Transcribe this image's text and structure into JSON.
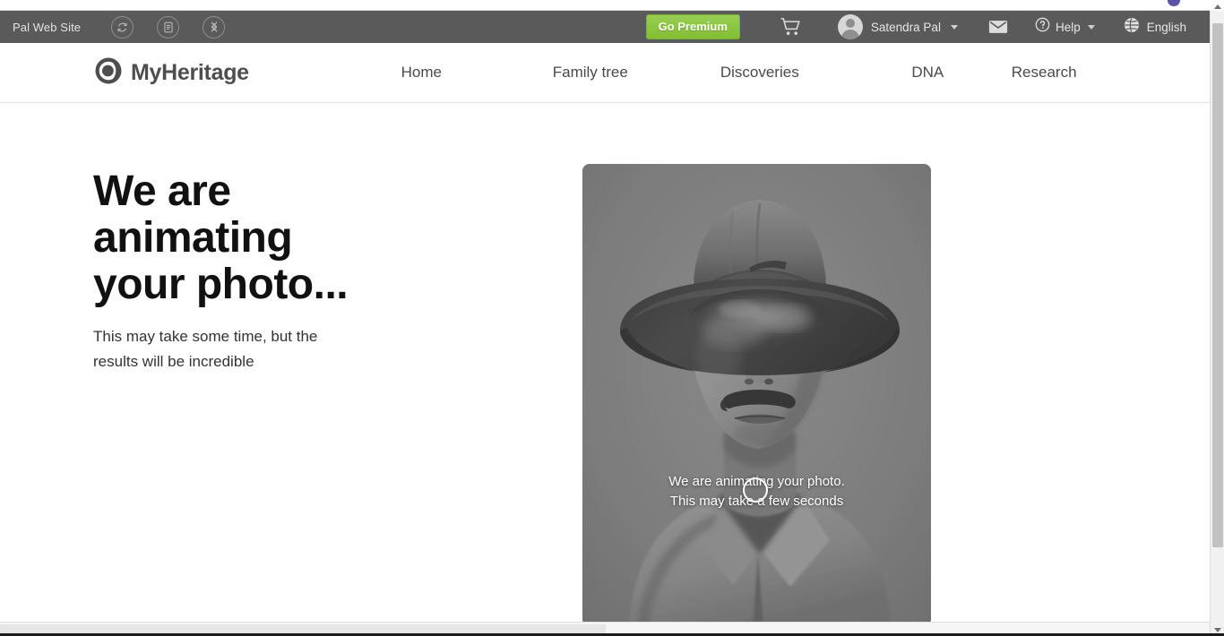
{
  "browser": {
    "tab_favicon_icon": "purple-circle-favicon"
  },
  "utility_bar": {
    "site_name": "Pal Web Site",
    "quick_icons": [
      {
        "name": "sync-icon",
        "label": "Sync"
      },
      {
        "name": "records-icon",
        "label": "Records"
      },
      {
        "name": "dna-icon",
        "label": "DNA"
      }
    ],
    "go_premium_label": "Go Premium",
    "cart_icon": "shopping-cart-icon",
    "user_name": "Satendra Pal",
    "avatar_icon": "user-avatar-icon",
    "mail_icon": "envelope-icon",
    "help_label": "Help",
    "help_icon": "question-mark-circle-icon",
    "language_label": "English",
    "language_icon": "globe-icon",
    "background_color": "#5a5a5a",
    "premium_color": "#8cc63f"
  },
  "navbar": {
    "brand_text": "MyHeritage",
    "brand_icon": "myheritage-logo-icon",
    "links": [
      {
        "label": "Home"
      },
      {
        "label": "Family tree"
      },
      {
        "label": "Discoveries"
      },
      {
        "label": "DNA"
      },
      {
        "label": "Research"
      }
    ]
  },
  "main": {
    "headline": "We are animating your photo...",
    "subhead": "This may take some time, but the results will be incredible",
    "photo": {
      "overlay_line1": "We are animating your photo.",
      "overlay_line2": "This may take a few seconds",
      "spinner_icon": "loading-spinner-icon",
      "description": "Black and white portrait of a man wearing a wide-brim hat with a mustache",
      "background_color": "#7a7a7a"
    }
  },
  "scrollbars": {
    "vertical_name": "vertical-scrollbar",
    "horizontal_name": "horizontal-scrollbar"
  }
}
